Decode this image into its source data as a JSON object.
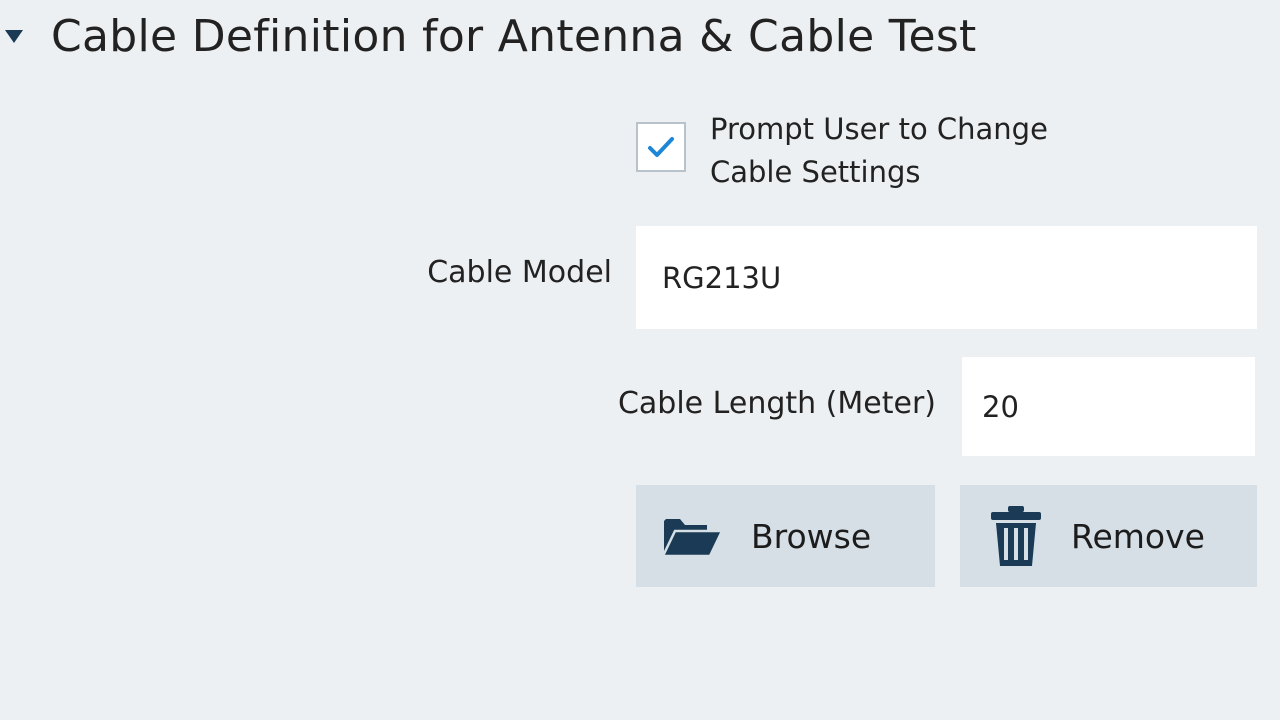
{
  "section": {
    "title": "Cable Definition for Antenna & Cable Test",
    "collapse_icon": "caret-down-icon"
  },
  "prompt": {
    "label": "Prompt User to Change Cable Settings",
    "checked": true
  },
  "cable_model": {
    "label": "Cable Model",
    "value": "RG213U"
  },
  "cable_length": {
    "label": "Cable Length (Meter)",
    "value": "20"
  },
  "buttons": {
    "browse_label": "Browse",
    "browse_icon": "folder-open-icon",
    "remove_label": "Remove",
    "remove_icon": "trash-icon"
  },
  "colors": {
    "background": "#edf0f2",
    "accent": "#1a3a55",
    "check": "#1e86d6",
    "button_bg": "#d6dfe6"
  }
}
